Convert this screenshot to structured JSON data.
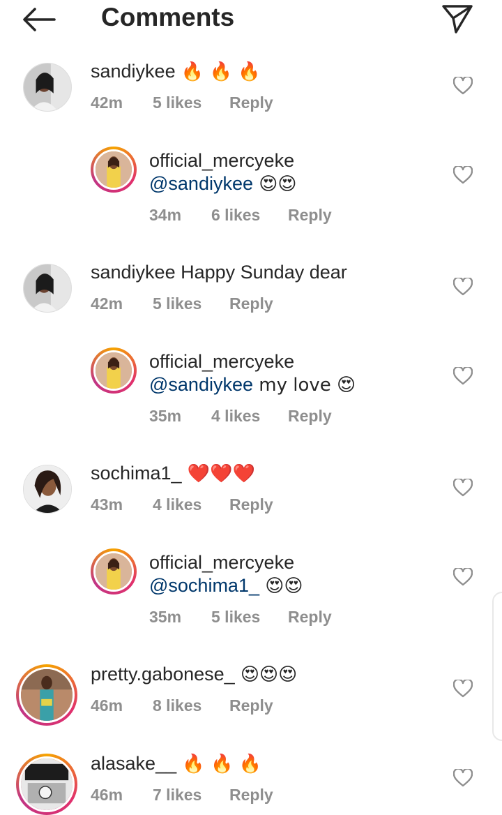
{
  "header": {
    "title": "Comments"
  },
  "comments": [
    {
      "user": "sandiykee",
      "mention": "",
      "text": " 🔥 🔥 🔥",
      "time": "42m",
      "likes": "5 likes",
      "reply": "Reply"
    },
    {
      "user": "official_mercyeke",
      "mention": "@sandiykee",
      "text": " 😍😍",
      "time": "34m",
      "likes": "6 likes",
      "reply": "Reply"
    },
    {
      "user": "sandiykee",
      "mention": "",
      "text": " Happy Sunday dear",
      "time": "42m",
      "likes": "5 likes",
      "reply": "Reply"
    },
    {
      "user": "official_mercyeke",
      "mention": "@sandiykee",
      "text": " my love 😍",
      "time": "35m",
      "likes": "4 likes",
      "reply": "Reply"
    },
    {
      "user": "sochima1_",
      "mention": "",
      "text": " ❤️❤️❤️",
      "time": "43m",
      "likes": "4 likes",
      "reply": "Reply"
    },
    {
      "user": "official_mercyeke",
      "mention": "@sochima1_",
      "text": " 😍😍",
      "time": "35m",
      "likes": "5 likes",
      "reply": "Reply"
    },
    {
      "user": "pretty.gabonese_",
      "mention": "",
      "text": " 😍😍😍",
      "time": "46m",
      "likes": "8 likes",
      "reply": "Reply"
    },
    {
      "user": "alasake__",
      "mention": "",
      "text": " 🔥 🔥 🔥",
      "time": "46m",
      "likes": "7 likes",
      "reply": "Reply"
    }
  ],
  "icons": {
    "back": "arrow-left-icon",
    "send": "paper-plane-icon",
    "like": "heart-outline-icon"
  },
  "colors": {
    "mention": "#00376b",
    "meta": "#8e8e8e",
    "text": "#262626"
  }
}
